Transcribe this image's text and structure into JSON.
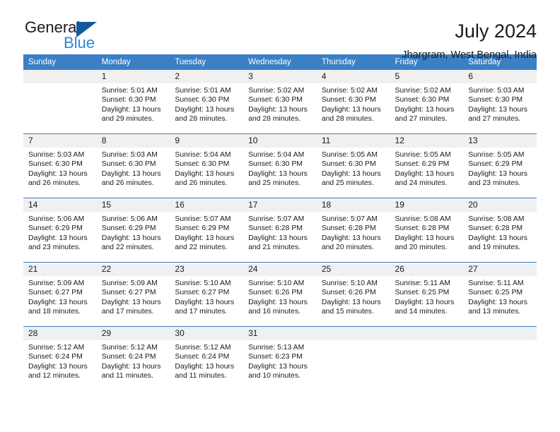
{
  "brand": {
    "name_top": "General",
    "name_bottom": "Blue",
    "triangle_icon": "blue-triangle-icon",
    "color_dark": "#1a1a1a",
    "color_blue": "#2a88d4"
  },
  "header": {
    "title": "July 2024",
    "subtitle": "Jhargram, West Bengal, India"
  },
  "theme": {
    "header_bg": "#3b7fc4",
    "header_text": "#ffffff",
    "daynum_bg": "#f0f0f0",
    "row_rule": "#3b7fc4"
  },
  "weekdays": [
    "Sunday",
    "Monday",
    "Tuesday",
    "Wednesday",
    "Thursday",
    "Friday",
    "Saturday"
  ],
  "labels": {
    "sunrise": "Sunrise:",
    "sunset": "Sunset:",
    "daylight": "Daylight:"
  },
  "weeks": [
    [
      {
        "day": "",
        "empty": true,
        "sunrise": "",
        "sunset": "",
        "daylight_line1": "",
        "daylight_line2": ""
      },
      {
        "day": "1",
        "empty": false,
        "sunrise": "Sunrise: 5:01 AM",
        "sunset": "Sunset: 6:30 PM",
        "daylight_line1": "Daylight: 13 hours",
        "daylight_line2": "and 29 minutes."
      },
      {
        "day": "2",
        "empty": false,
        "sunrise": "Sunrise: 5:01 AM",
        "sunset": "Sunset: 6:30 PM",
        "daylight_line1": "Daylight: 13 hours",
        "daylight_line2": "and 28 minutes."
      },
      {
        "day": "3",
        "empty": false,
        "sunrise": "Sunrise: 5:02 AM",
        "sunset": "Sunset: 6:30 PM",
        "daylight_line1": "Daylight: 13 hours",
        "daylight_line2": "and 28 minutes."
      },
      {
        "day": "4",
        "empty": false,
        "sunrise": "Sunrise: 5:02 AM",
        "sunset": "Sunset: 6:30 PM",
        "daylight_line1": "Daylight: 13 hours",
        "daylight_line2": "and 28 minutes."
      },
      {
        "day": "5",
        "empty": false,
        "sunrise": "Sunrise: 5:02 AM",
        "sunset": "Sunset: 6:30 PM",
        "daylight_line1": "Daylight: 13 hours",
        "daylight_line2": "and 27 minutes."
      },
      {
        "day": "6",
        "empty": false,
        "sunrise": "Sunrise: 5:03 AM",
        "sunset": "Sunset: 6:30 PM",
        "daylight_line1": "Daylight: 13 hours",
        "daylight_line2": "and 27 minutes."
      }
    ],
    [
      {
        "day": "7",
        "empty": false,
        "sunrise": "Sunrise: 5:03 AM",
        "sunset": "Sunset: 6:30 PM",
        "daylight_line1": "Daylight: 13 hours",
        "daylight_line2": "and 26 minutes."
      },
      {
        "day": "8",
        "empty": false,
        "sunrise": "Sunrise: 5:03 AM",
        "sunset": "Sunset: 6:30 PM",
        "daylight_line1": "Daylight: 13 hours",
        "daylight_line2": "and 26 minutes."
      },
      {
        "day": "9",
        "empty": false,
        "sunrise": "Sunrise: 5:04 AM",
        "sunset": "Sunset: 6:30 PM",
        "daylight_line1": "Daylight: 13 hours",
        "daylight_line2": "and 26 minutes."
      },
      {
        "day": "10",
        "empty": false,
        "sunrise": "Sunrise: 5:04 AM",
        "sunset": "Sunset: 6:30 PM",
        "daylight_line1": "Daylight: 13 hours",
        "daylight_line2": "and 25 minutes."
      },
      {
        "day": "11",
        "empty": false,
        "sunrise": "Sunrise: 5:05 AM",
        "sunset": "Sunset: 6:30 PM",
        "daylight_line1": "Daylight: 13 hours",
        "daylight_line2": "and 25 minutes."
      },
      {
        "day": "12",
        "empty": false,
        "sunrise": "Sunrise: 5:05 AM",
        "sunset": "Sunset: 6:29 PM",
        "daylight_line1": "Daylight: 13 hours",
        "daylight_line2": "and 24 minutes."
      },
      {
        "day": "13",
        "empty": false,
        "sunrise": "Sunrise: 5:05 AM",
        "sunset": "Sunset: 6:29 PM",
        "daylight_line1": "Daylight: 13 hours",
        "daylight_line2": "and 23 minutes."
      }
    ],
    [
      {
        "day": "14",
        "empty": false,
        "sunrise": "Sunrise: 5:06 AM",
        "sunset": "Sunset: 6:29 PM",
        "daylight_line1": "Daylight: 13 hours",
        "daylight_line2": "and 23 minutes."
      },
      {
        "day": "15",
        "empty": false,
        "sunrise": "Sunrise: 5:06 AM",
        "sunset": "Sunset: 6:29 PM",
        "daylight_line1": "Daylight: 13 hours",
        "daylight_line2": "and 22 minutes."
      },
      {
        "day": "16",
        "empty": false,
        "sunrise": "Sunrise: 5:07 AM",
        "sunset": "Sunset: 6:29 PM",
        "daylight_line1": "Daylight: 13 hours",
        "daylight_line2": "and 22 minutes."
      },
      {
        "day": "17",
        "empty": false,
        "sunrise": "Sunrise: 5:07 AM",
        "sunset": "Sunset: 6:28 PM",
        "daylight_line1": "Daylight: 13 hours",
        "daylight_line2": "and 21 minutes."
      },
      {
        "day": "18",
        "empty": false,
        "sunrise": "Sunrise: 5:07 AM",
        "sunset": "Sunset: 6:28 PM",
        "daylight_line1": "Daylight: 13 hours",
        "daylight_line2": "and 20 minutes."
      },
      {
        "day": "19",
        "empty": false,
        "sunrise": "Sunrise: 5:08 AM",
        "sunset": "Sunset: 6:28 PM",
        "daylight_line1": "Daylight: 13 hours",
        "daylight_line2": "and 20 minutes."
      },
      {
        "day": "20",
        "empty": false,
        "sunrise": "Sunrise: 5:08 AM",
        "sunset": "Sunset: 6:28 PM",
        "daylight_line1": "Daylight: 13 hours",
        "daylight_line2": "and 19 minutes."
      }
    ],
    [
      {
        "day": "21",
        "empty": false,
        "sunrise": "Sunrise: 5:09 AM",
        "sunset": "Sunset: 6:27 PM",
        "daylight_line1": "Daylight: 13 hours",
        "daylight_line2": "and 18 minutes."
      },
      {
        "day": "22",
        "empty": false,
        "sunrise": "Sunrise: 5:09 AM",
        "sunset": "Sunset: 6:27 PM",
        "daylight_line1": "Daylight: 13 hours",
        "daylight_line2": "and 17 minutes."
      },
      {
        "day": "23",
        "empty": false,
        "sunrise": "Sunrise: 5:10 AM",
        "sunset": "Sunset: 6:27 PM",
        "daylight_line1": "Daylight: 13 hours",
        "daylight_line2": "and 17 minutes."
      },
      {
        "day": "24",
        "empty": false,
        "sunrise": "Sunrise: 5:10 AM",
        "sunset": "Sunset: 6:26 PM",
        "daylight_line1": "Daylight: 13 hours",
        "daylight_line2": "and 16 minutes."
      },
      {
        "day": "25",
        "empty": false,
        "sunrise": "Sunrise: 5:10 AM",
        "sunset": "Sunset: 6:26 PM",
        "daylight_line1": "Daylight: 13 hours",
        "daylight_line2": "and 15 minutes."
      },
      {
        "day": "26",
        "empty": false,
        "sunrise": "Sunrise: 5:11 AM",
        "sunset": "Sunset: 6:25 PM",
        "daylight_line1": "Daylight: 13 hours",
        "daylight_line2": "and 14 minutes."
      },
      {
        "day": "27",
        "empty": false,
        "sunrise": "Sunrise: 5:11 AM",
        "sunset": "Sunset: 6:25 PM",
        "daylight_line1": "Daylight: 13 hours",
        "daylight_line2": "and 13 minutes."
      }
    ],
    [
      {
        "day": "28",
        "empty": false,
        "sunrise": "Sunrise: 5:12 AM",
        "sunset": "Sunset: 6:24 PM",
        "daylight_line1": "Daylight: 13 hours",
        "daylight_line2": "and 12 minutes."
      },
      {
        "day": "29",
        "empty": false,
        "sunrise": "Sunrise: 5:12 AM",
        "sunset": "Sunset: 6:24 PM",
        "daylight_line1": "Daylight: 13 hours",
        "daylight_line2": "and 11 minutes."
      },
      {
        "day": "30",
        "empty": false,
        "sunrise": "Sunrise: 5:12 AM",
        "sunset": "Sunset: 6:24 PM",
        "daylight_line1": "Daylight: 13 hours",
        "daylight_line2": "and 11 minutes."
      },
      {
        "day": "31",
        "empty": false,
        "sunrise": "Sunrise: 5:13 AM",
        "sunset": "Sunset: 6:23 PM",
        "daylight_line1": "Daylight: 13 hours",
        "daylight_line2": "and 10 minutes."
      },
      {
        "day": "",
        "empty": true,
        "sunrise": "",
        "sunset": "",
        "daylight_line1": "",
        "daylight_line2": ""
      },
      {
        "day": "",
        "empty": true,
        "sunrise": "",
        "sunset": "",
        "daylight_line1": "",
        "daylight_line2": ""
      },
      {
        "day": "",
        "empty": true,
        "sunrise": "",
        "sunset": "",
        "daylight_line1": "",
        "daylight_line2": ""
      }
    ]
  ]
}
